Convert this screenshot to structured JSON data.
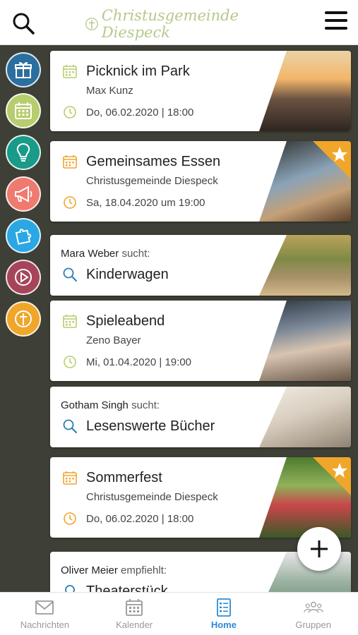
{
  "header": {
    "logo_text": "Christusgemeinde Diespeck",
    "brand_color": "#b6c98a"
  },
  "sidebar": {
    "categories": [
      {
        "icon": "gift-icon",
        "color": "#2a6fa0"
      },
      {
        "icon": "calendar-icon",
        "color": "#b7cd6e"
      },
      {
        "icon": "lightbulb-icon",
        "color": "#1a9a88"
      },
      {
        "icon": "megaphone-icon",
        "color": "#ef7a6f"
      },
      {
        "icon": "puzzle-icon",
        "color": "#2aa7e4"
      },
      {
        "icon": "play-icon",
        "color": "#a6455a"
      },
      {
        "icon": "church-cross-icon",
        "color": "#f0a62a"
      }
    ]
  },
  "feed": {
    "cards": [
      {
        "title": "Picknick im Park",
        "subtitle": "Max Kunz",
        "date": "Do, 06.02.2020 | 18:00"
      },
      {
        "title": "Gemeinsames Essen",
        "subtitle": "Christusgemeinde Diespeck",
        "date": "Sa, 18.04.2020 um 19:00"
      },
      {
        "name": "Mara Weber",
        "verb": "sucht:",
        "title": "Kinderwagen"
      },
      {
        "title": "Spieleabend",
        "subtitle": "Zeno Bayer",
        "date": "Mi, 01.04.2020 | 19:00"
      },
      {
        "name": "Gotham Singh",
        "verb": "sucht:",
        "title": "Lesenswerte Bücher"
      },
      {
        "title": "Sommerfest",
        "subtitle": "Christusgemeinde Diespeck",
        "date": "Do, 06.02.2020 | 18:00"
      },
      {
        "name": "Oliver Meier",
        "verb": "empfiehlt:",
        "title": "Theaterstück"
      }
    ]
  },
  "bottom_nav": {
    "tabs": [
      {
        "label": "Nachrichten",
        "icon": "mail-icon"
      },
      {
        "label": "Kalender",
        "icon": "calendar-icon"
      },
      {
        "label": "Home",
        "icon": "list-icon",
        "active": true
      },
      {
        "label": "Gruppen",
        "icon": "group-icon"
      }
    ]
  },
  "colors": {
    "event_green": "#b7cd6e",
    "event_orange": "#f0a62a",
    "search_blue": "#2a7db5",
    "active_blue": "#2b8bd6"
  }
}
